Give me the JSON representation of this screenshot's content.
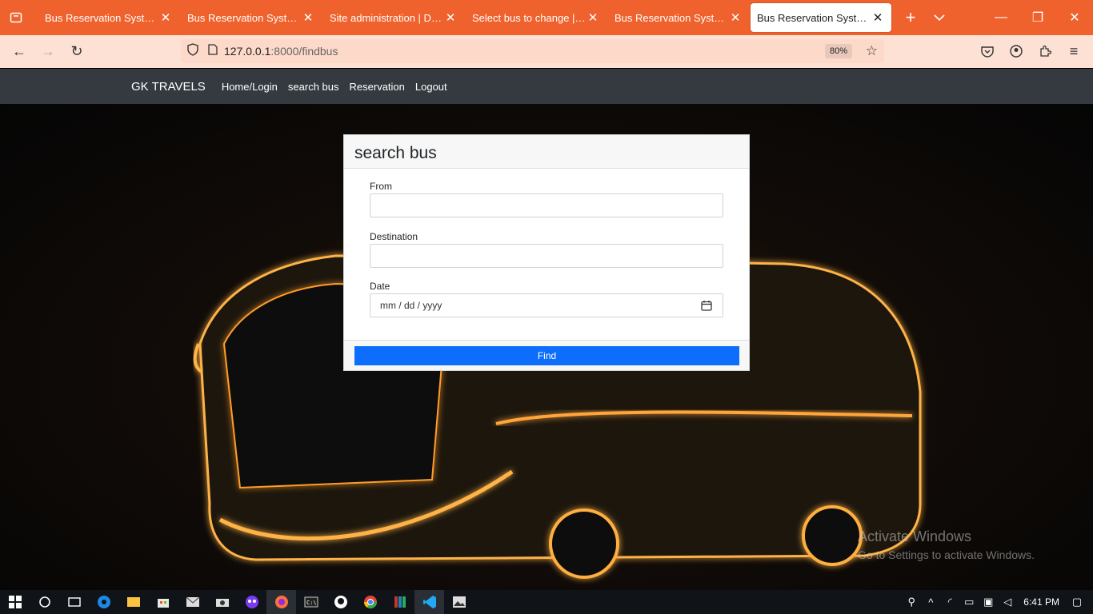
{
  "browser": {
    "tabs": [
      {
        "title": "Bus Reservation System in",
        "active": false
      },
      {
        "title": "Bus Reservation System in",
        "active": false
      },
      {
        "title": "Site administration | Django",
        "active": false
      },
      {
        "title": "Select bus to change | Django",
        "active": false
      },
      {
        "title": "Bus Reservation System in",
        "active": false
      },
      {
        "title": "Bus Reservation System in",
        "active": true
      }
    ],
    "url_host": "127.0.0.1",
    "url_path": ":8000/findbus",
    "zoom": "80%"
  },
  "site": {
    "brand": "GK TRAVELS",
    "nav": [
      "Home/Login",
      "search bus",
      "Reservation",
      "Logout"
    ]
  },
  "form": {
    "title": "search bus",
    "from_label": "From",
    "destination_label": "Destination",
    "date_label": "Date",
    "date_placeholder": "mm / dd / yyyy",
    "submit_label": "Find"
  },
  "watermark": {
    "line1": "Activate Windows",
    "line2": "Go to Settings to activate Windows."
  },
  "taskbar": {
    "time": "6:41 PM"
  },
  "colors": {
    "tabbar": "#f0622d",
    "site_header": "#343a40",
    "primary_button": "#0d6efd"
  }
}
